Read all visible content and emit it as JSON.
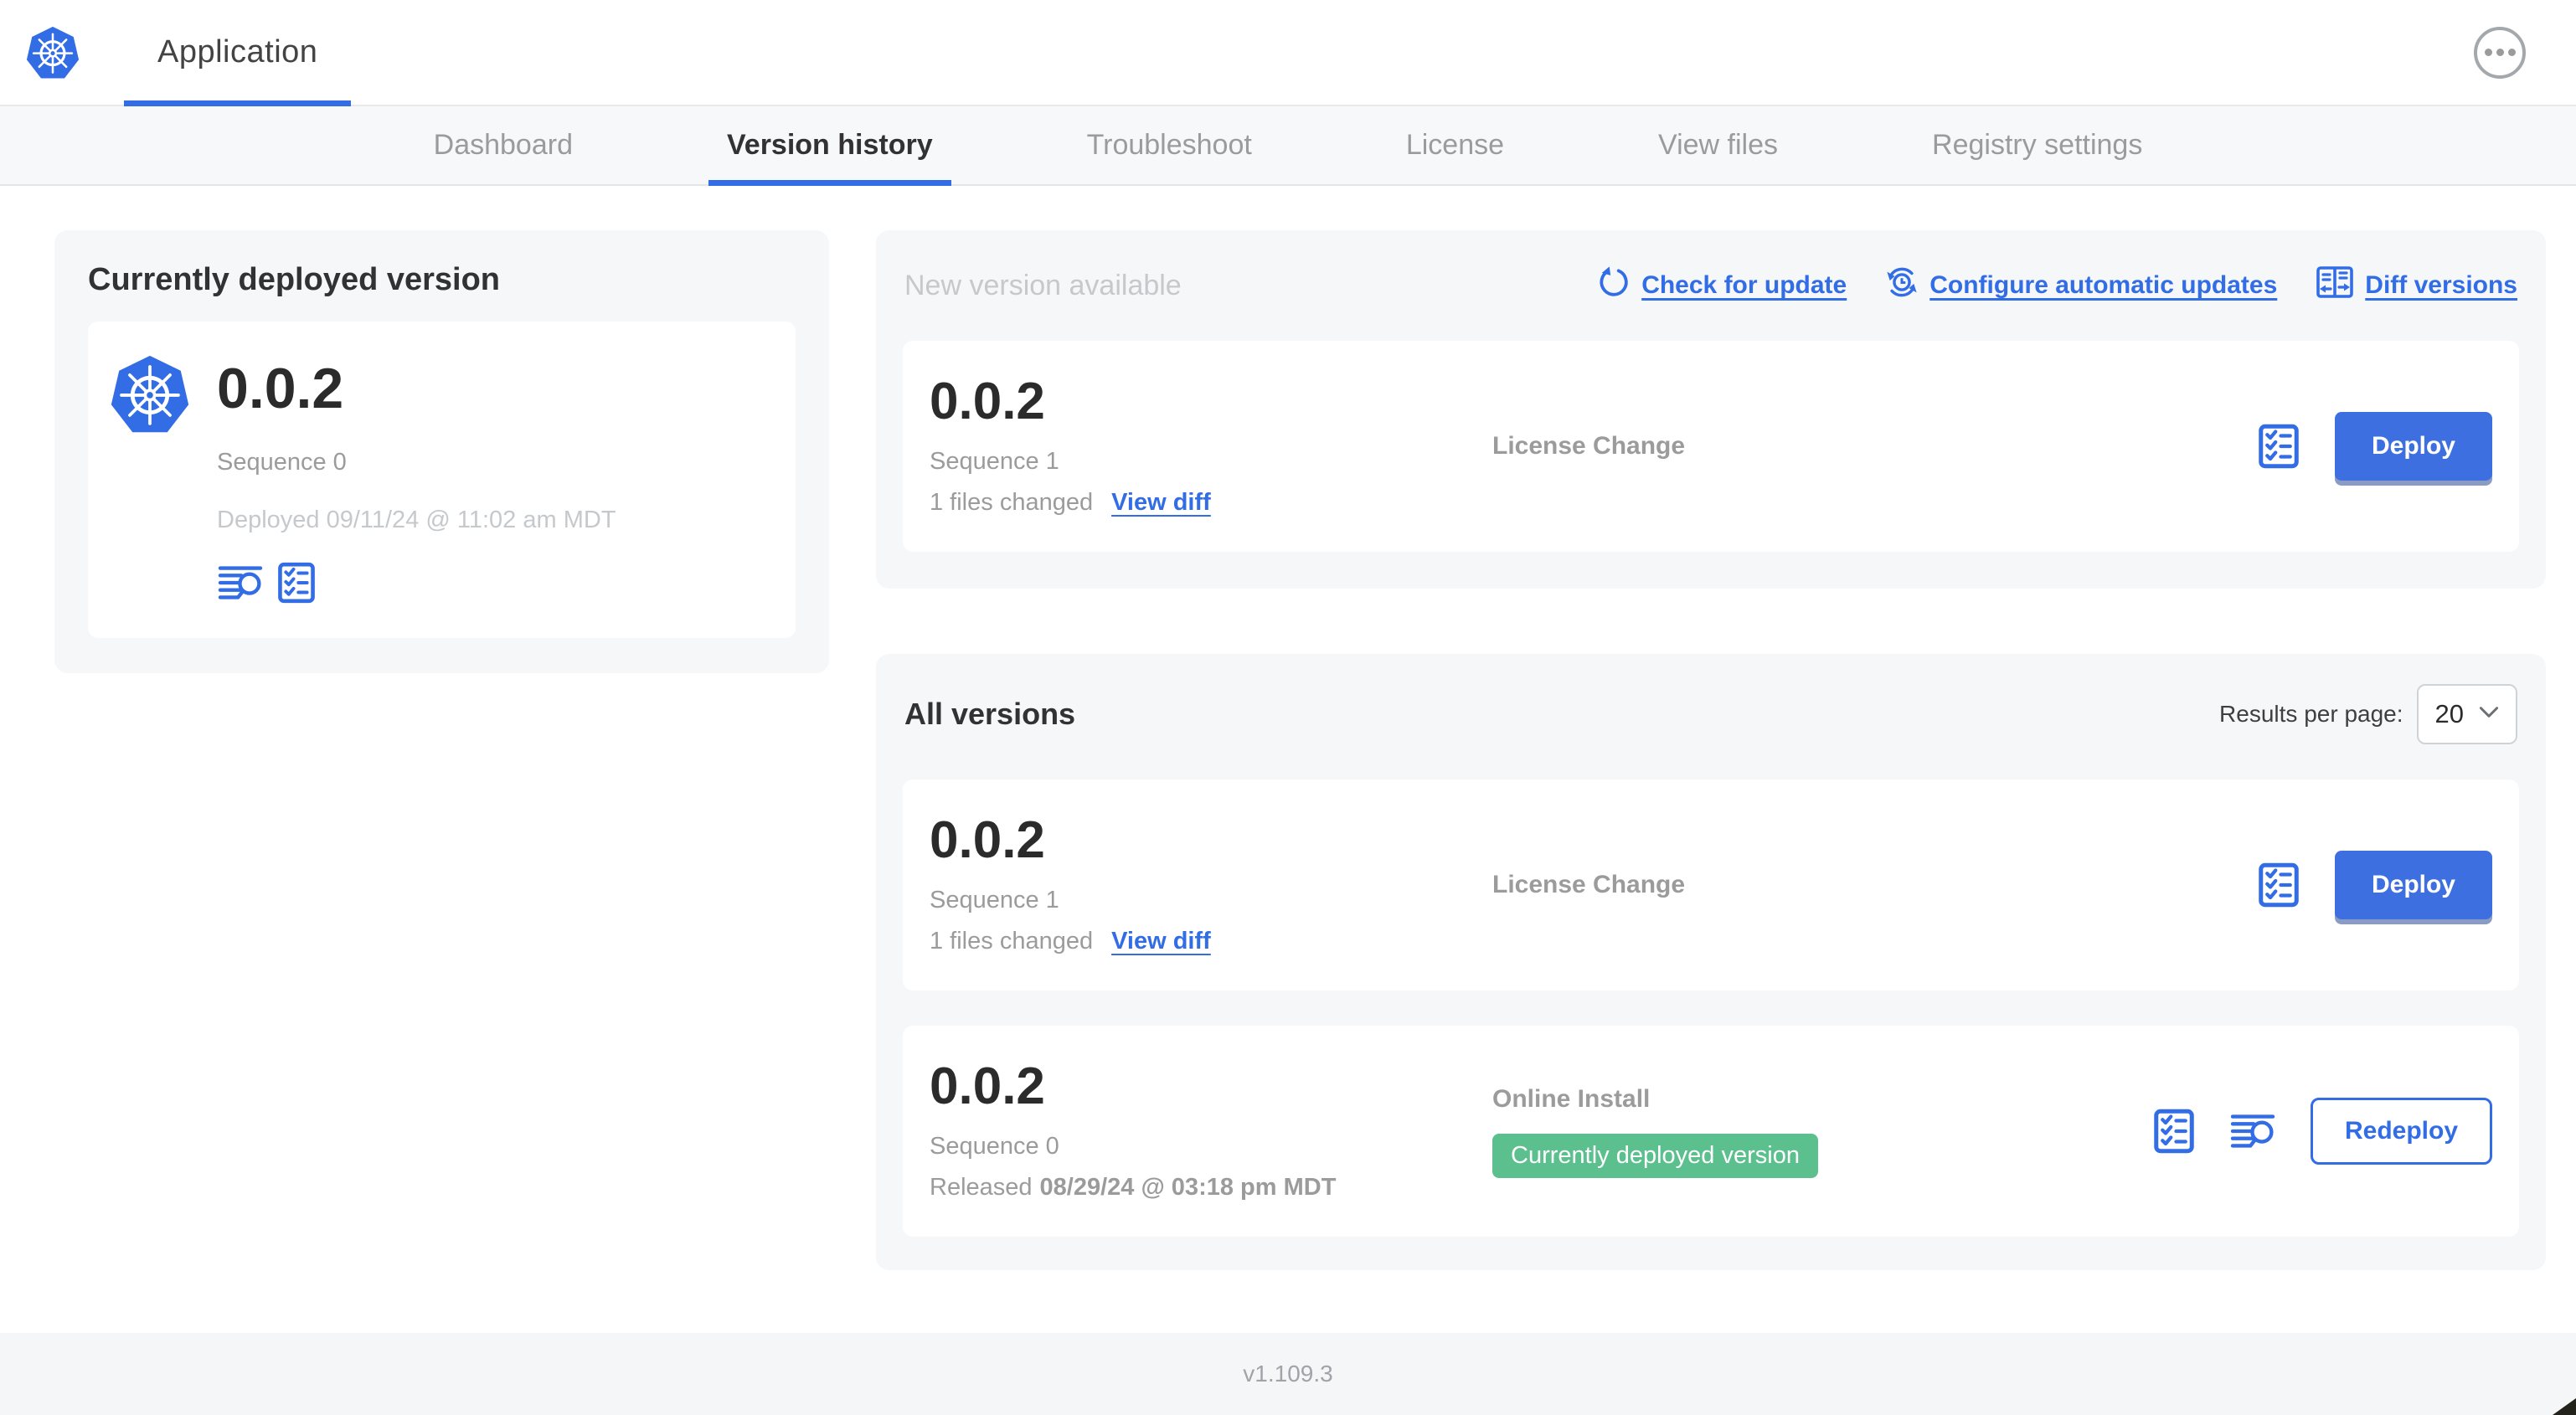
{
  "colors": {
    "primary_blue": "#326de6",
    "badge_green": "#5cc08e",
    "panel_gray": "#f5f7f9",
    "muted_text": "#9b9b9b",
    "faint_text": "#c6c9cc",
    "dark_text": "#323232"
  },
  "header": {
    "app_title": "Application"
  },
  "nav": {
    "tabs": [
      {
        "label": "Dashboard",
        "active": false
      },
      {
        "label": "Version history",
        "active": true
      },
      {
        "label": "Troubleshoot",
        "active": false
      },
      {
        "label": "License",
        "active": false
      },
      {
        "label": "View files",
        "active": false
      },
      {
        "label": "Registry settings",
        "active": false
      }
    ]
  },
  "current_version": {
    "title": "Currently deployed version",
    "version": "0.0.2",
    "sequence": "Sequence 0",
    "deployed": "Deployed 09/11/24 @ 11:02 am MDT"
  },
  "new_version": {
    "title": "New version available",
    "actions": {
      "check_for_update": "Check for update",
      "configure_automatic_updates": "Configure automatic updates",
      "diff_versions": "Diff versions"
    },
    "row": {
      "version": "0.0.2",
      "sequence": "Sequence 1",
      "files_changed": "1 files changed",
      "view_diff": "View diff",
      "source": "License Change",
      "deploy_label": "Deploy"
    }
  },
  "all_versions": {
    "title": "All versions",
    "results_per_page_label": "Results per page:",
    "results_per_page_value": "20",
    "rows": [
      {
        "version": "0.0.2",
        "sequence": "Sequence 1",
        "files_changed": "1 files changed",
        "view_diff": "View diff",
        "source": "License Change",
        "deploy_label": "Deploy"
      },
      {
        "version": "0.0.2",
        "sequence": "Sequence 0",
        "released_prefix": "Released",
        "released_date": "08/29/24 @ 03:18 pm MDT",
        "source": "Online Install",
        "badge": "Currently deployed version",
        "redeploy_label": "Redeploy"
      }
    ]
  },
  "footer": {
    "app_version": "v1.109.3"
  }
}
